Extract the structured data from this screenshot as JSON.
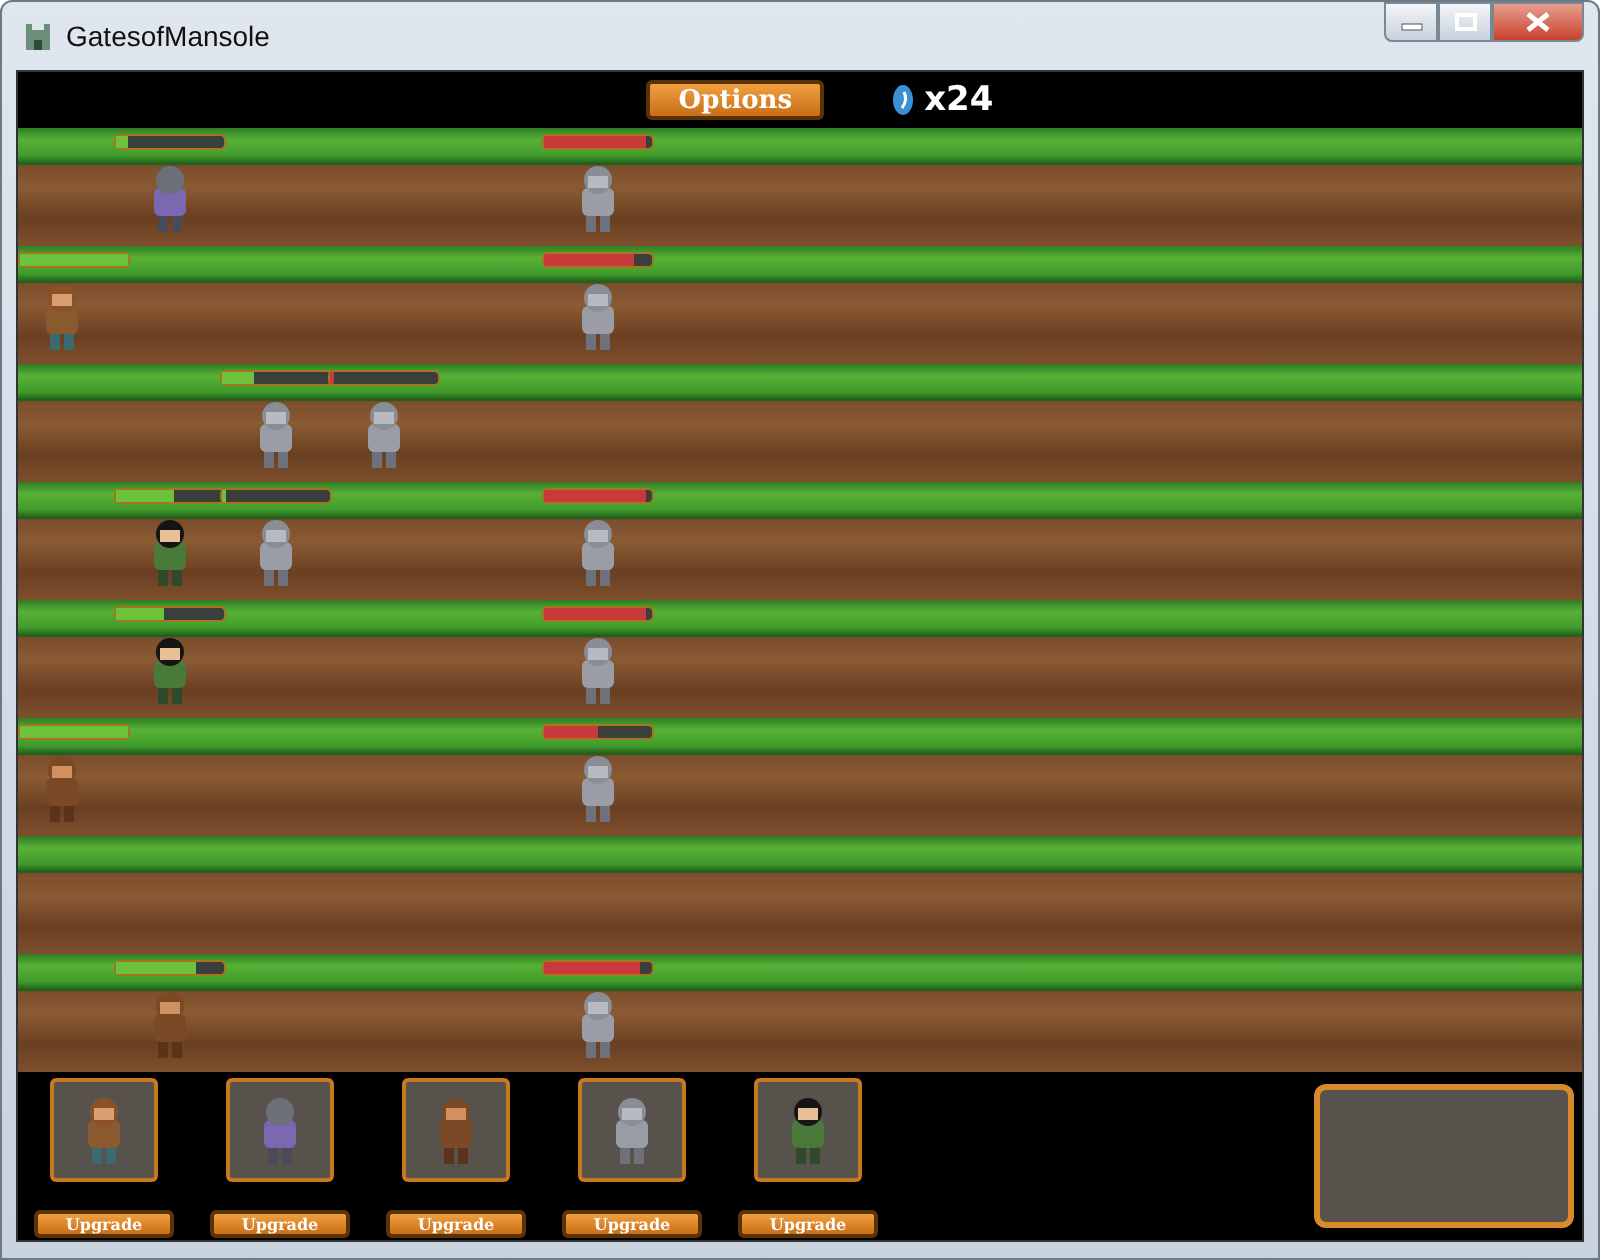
{
  "window": {
    "title": "GatesofMansole"
  },
  "top_bar": {
    "options_button": "Options",
    "gems": "x24"
  },
  "lanes": [
    {
      "kind": "dirt",
      "units": [
        {
          "kind": "spearman",
          "enemy": false,
          "level": 0.12
        },
        {
          "kind": "knight",
          "enemy": true,
          "level": 0.95
        }
      ]
    },
    {
      "kind": "dirt",
      "units": [
        {
          "kind": "ranger",
          "enemy": false,
          "level": 1
        },
        {
          "kind": "knight",
          "enemy": true,
          "level": 0.85
        }
      ]
    },
    {
      "kind": "dirt",
      "units": [
        {
          "kind": "knight",
          "enemy": false,
          "level": 0.3
        },
        {
          "kind": "knight",
          "enemy": true,
          "level": 0.05
        }
      ]
    },
    {
      "kind": "dirt",
      "units": [
        {
          "kind": "villager",
          "enemy": false,
          "level": 0.55
        },
        {
          "kind": "knight",
          "enemy": false,
          "level": 0.04
        },
        {
          "kind": "knight",
          "enemy": true,
          "level": 0.95
        }
      ]
    },
    {
      "kind": "dirt",
      "units": [
        {
          "kind": "villager",
          "enemy": false,
          "level": 0.45
        },
        {
          "kind": "knight",
          "enemy": true,
          "level": 0.95
        }
      ]
    },
    {
      "kind": "dirt",
      "units": [
        {
          "kind": "monk",
          "enemy": false,
          "level": 1
        },
        {
          "kind": "knight",
          "enemy": true,
          "level": 0.5
        }
      ]
    },
    {
      "kind": "dirt"
    },
    {
      "kind": "dirt",
      "units": [
        {
          "kind": "monk",
          "enemy": false,
          "level": 0.75
        },
        {
          "kind": "knight",
          "enemy": true,
          "level": 0.9
        }
      ]
    }
  ],
  "recruits": [
    {
      "kind": "ranger",
      "button": "Upgrade"
    },
    {
      "kind": "spearman",
      "button": "Upgrade"
    },
    {
      "kind": "monk",
      "button": "Upgrade"
    },
    {
      "kind": "knight",
      "button": "Upgrade"
    },
    {
      "kind": "villager",
      "button": "Upgrade"
    }
  ]
}
